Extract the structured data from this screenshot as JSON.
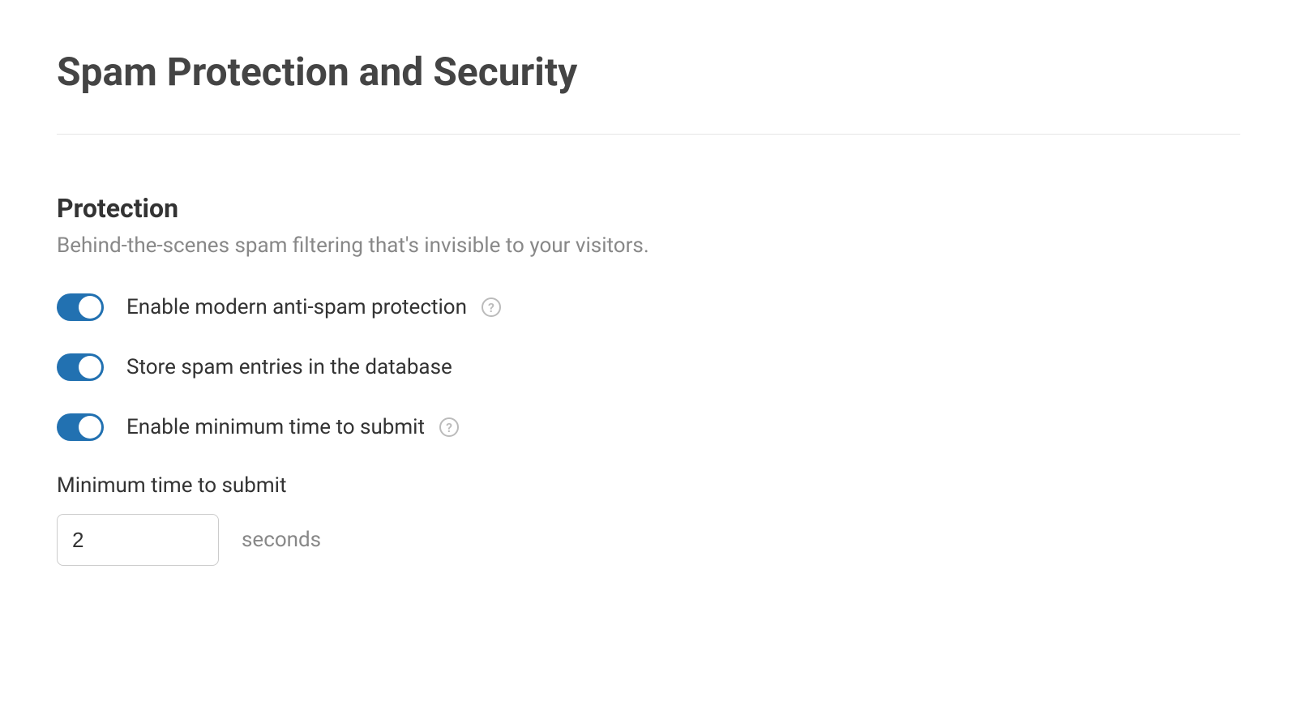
{
  "page": {
    "title": "Spam Protection and Security"
  },
  "section": {
    "title": "Protection",
    "description": "Behind-the-scenes spam filtering that's invisible to your visitors."
  },
  "toggles": {
    "antispam": {
      "label": "Enable modern anti-spam protection",
      "enabled": true,
      "has_help": true
    },
    "store_spam": {
      "label": "Store spam entries in the database",
      "enabled": true,
      "has_help": false
    },
    "min_time": {
      "label": "Enable minimum time to submit",
      "enabled": true,
      "has_help": true
    }
  },
  "min_time_field": {
    "label": "Minimum time to submit",
    "value": "2",
    "suffix": "seconds"
  },
  "help_glyph": "?"
}
